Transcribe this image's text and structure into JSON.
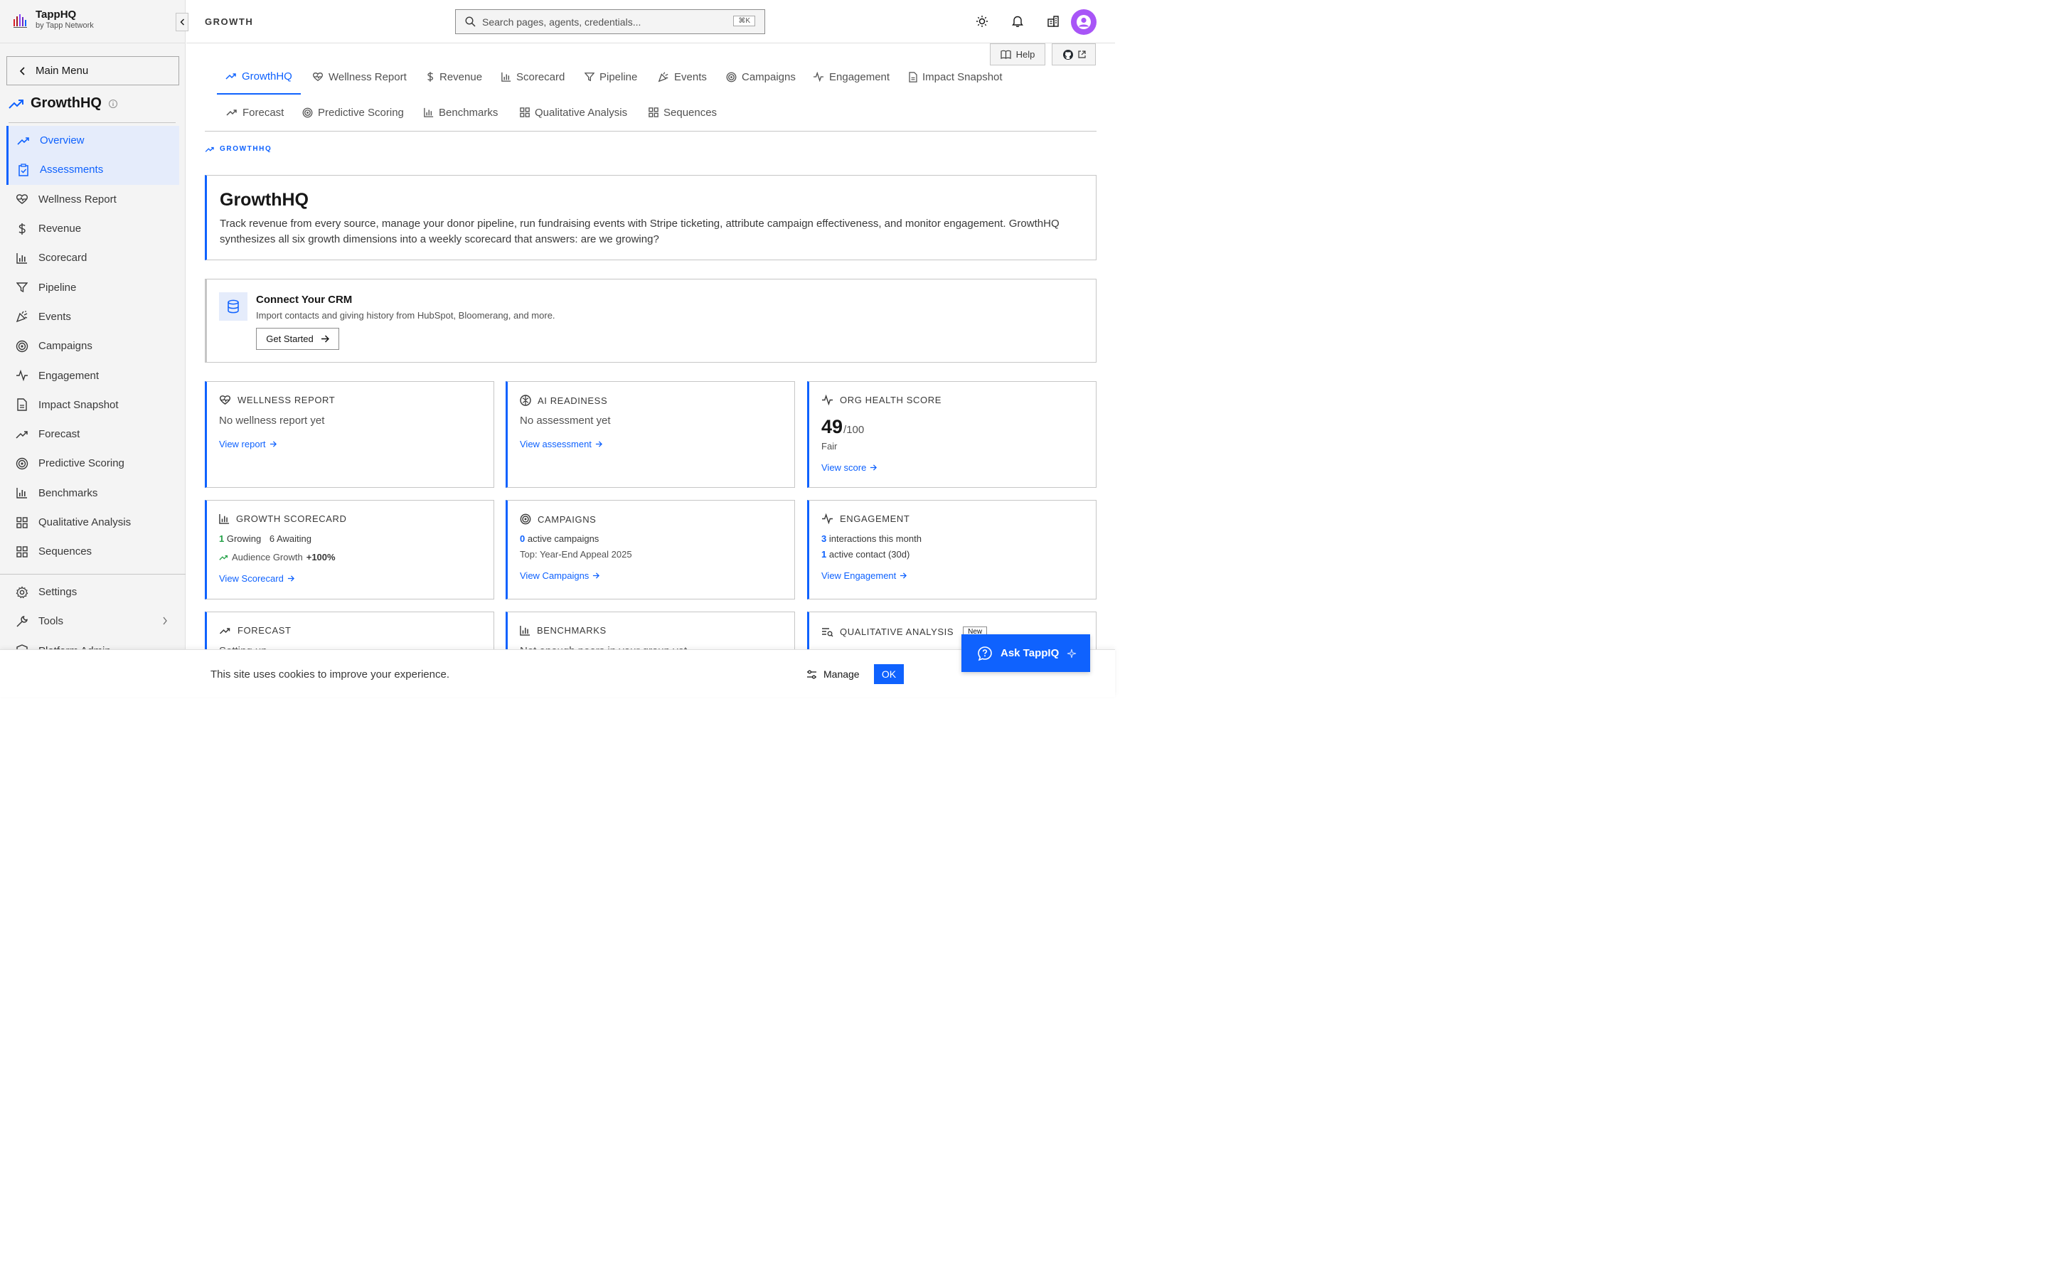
{
  "brand": {
    "name": "TappHQ",
    "sub": "by Tapp Network"
  },
  "sidebar": {
    "main_menu_label": "Main Menu",
    "section_title": "GrowthHQ",
    "items": [
      {
        "label": "Overview",
        "icon": "trend-up-icon",
        "active": true
      },
      {
        "label": "Assessments",
        "icon": "clipboard-icon",
        "active": true
      },
      {
        "label": "Wellness Report",
        "icon": "heart-pulse-icon"
      },
      {
        "label": "Revenue",
        "icon": "dollar-icon"
      },
      {
        "label": "Scorecard",
        "icon": "bar-chart-icon"
      },
      {
        "label": "Pipeline",
        "icon": "funnel-icon"
      },
      {
        "label": "Events",
        "icon": "party-icon"
      },
      {
        "label": "Campaigns",
        "icon": "target-icon"
      },
      {
        "label": "Engagement",
        "icon": "activity-icon"
      },
      {
        "label": "Impact Snapshot",
        "icon": "document-icon"
      },
      {
        "label": "Forecast",
        "icon": "trend-up-icon"
      },
      {
        "label": "Predictive Scoring",
        "icon": "target-icon"
      },
      {
        "label": "Benchmarks",
        "icon": "bar-chart-icon"
      },
      {
        "label": "Qualitative Analysis",
        "icon": "grid-icon"
      },
      {
        "label": "Sequences",
        "icon": "grid-icon"
      }
    ],
    "bottom_items": [
      {
        "label": "Settings",
        "icon": "gear-icon"
      },
      {
        "label": "Tools",
        "icon": "wrench-icon"
      },
      {
        "label": "Platform Admin",
        "icon": "shield-icon"
      }
    ]
  },
  "topbar": {
    "crumb": "GROWTH",
    "search_placeholder": "Search pages, agents, credentials...",
    "shortcut": "⌘K",
    "help_label": "Help"
  },
  "tabs": {
    "row1": [
      "GrowthHQ",
      "Wellness Report",
      "Revenue",
      "Scorecard",
      "Pipeline",
      "Events",
      "Campaigns",
      "Engagement",
      "Impact Snapshot"
    ],
    "row2": [
      "Forecast",
      "Predictive Scoring",
      "Benchmarks",
      "Qualitative Analysis",
      "Sequences"
    ]
  },
  "eyebrow": "GROWTHHQ",
  "hero": {
    "title": "GrowthHQ",
    "description": "Track revenue from every source, manage your donor pipeline, run fundraising events with Stripe ticketing, attribute campaign effectiveness, and monitor engagement. GrowthHQ synthesizes all six growth dimensions into a weekly scorecard that answers: are we growing?"
  },
  "crm": {
    "title": "Connect Your CRM",
    "description": "Import contacts and giving history from HubSpot, Bloomerang, and more.",
    "button": "Get Started"
  },
  "cards": {
    "wellness": {
      "title": "WELLNESS REPORT",
      "text": "No wellness report yet",
      "link": "View report"
    },
    "ai": {
      "title": "AI READINESS",
      "text": "No assessment yet",
      "link": "View assessment"
    },
    "health": {
      "title": "ORG HEALTH SCORE",
      "score": "49",
      "denominator": "/100",
      "rating": "Fair",
      "link": "View score"
    },
    "scorecard": {
      "title": "GROWTH SCORECARD",
      "growing_count": "1",
      "growing_label": "Growing",
      "awaiting": "6 Awaiting",
      "trend_label": "Audience Growth",
      "trend_value": "+100%",
      "link": "View Scorecard"
    },
    "campaigns": {
      "title": "CAMPAIGNS",
      "count": "0",
      "count_label": "active campaigns",
      "top": "Top: Year-End Appeal 2025",
      "link": "View Campaigns"
    },
    "engagement": {
      "title": "ENGAGEMENT",
      "interactions": "3",
      "interactions_label": "interactions this month",
      "contacts": "1",
      "contacts_label": "active contact (30d)",
      "link": "View Engagement"
    },
    "forecast": {
      "title": "FORECAST",
      "text": "Setting up"
    },
    "benchmarks": {
      "title": "BENCHMARKS",
      "text": "Not enough peers in your group yet"
    },
    "qualitative": {
      "title": "QUALITATIVE ANALYSIS",
      "badge": "New"
    }
  },
  "cookie": {
    "text": "This site uses cookies to improve your experience.",
    "manage": "Manage",
    "ok": "OK"
  },
  "ask": {
    "label": "Ask TappIQ"
  },
  "colors": {
    "accent": "#0f62fe",
    "green": "#24a148",
    "avatar": "#a855f7"
  }
}
